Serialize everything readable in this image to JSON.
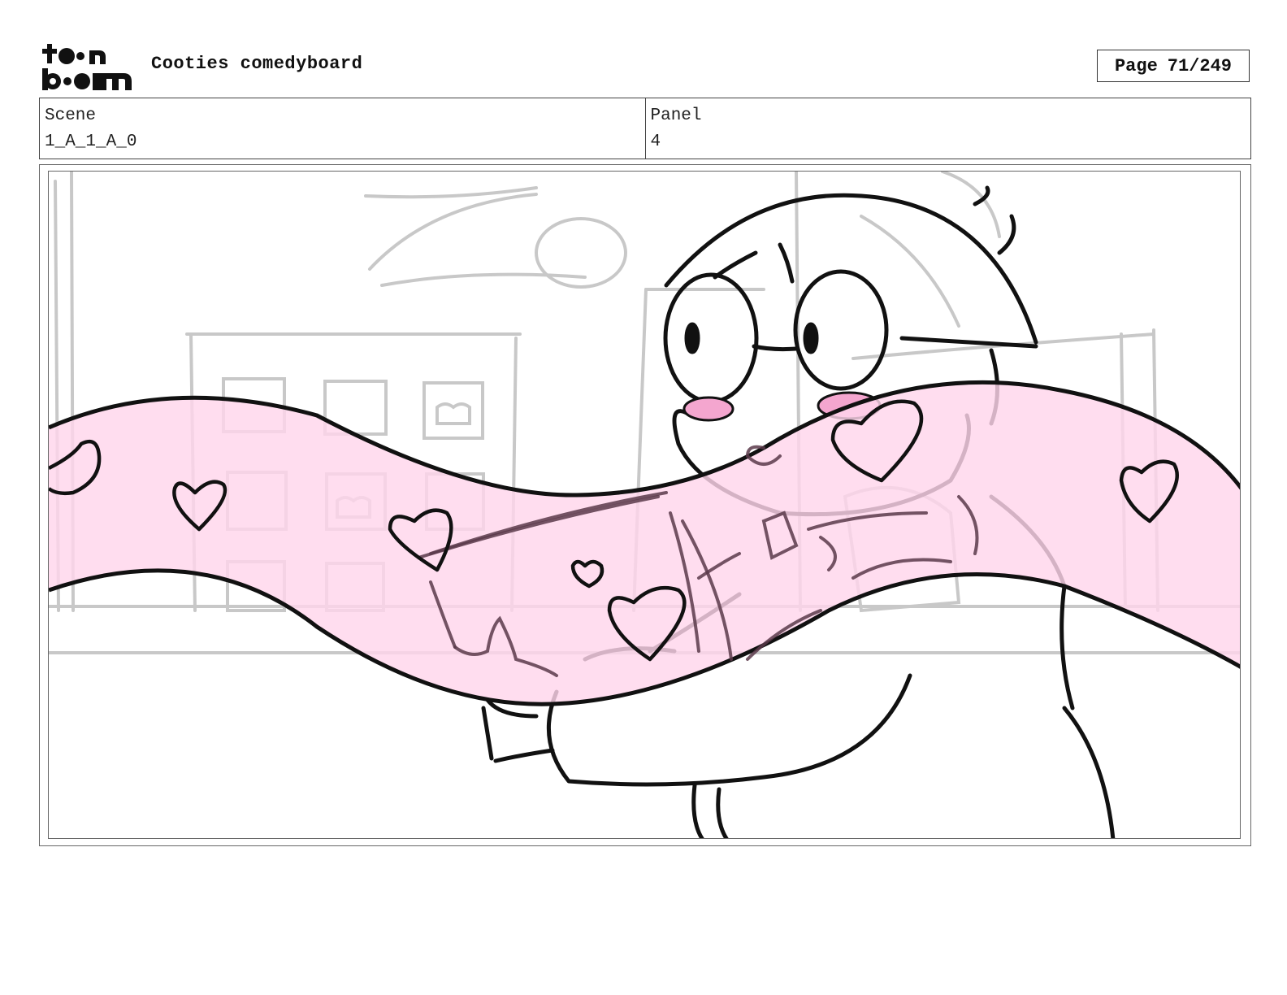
{
  "header": {
    "logo_alt": "toon boom",
    "title": "Cooties comedyboard",
    "page_label": "Page",
    "page_value": "71/249"
  },
  "info": {
    "scene_label": "Scene",
    "scene_value": "1_A_1_A_0",
    "panel_label": "Panel",
    "panel_value": "4"
  },
  "colors": {
    "ribbon_fill": "#ffd6ec",
    "blush": "#f4a6cf",
    "sketch_grey": "#c8c8c8",
    "ink": "#111111"
  }
}
